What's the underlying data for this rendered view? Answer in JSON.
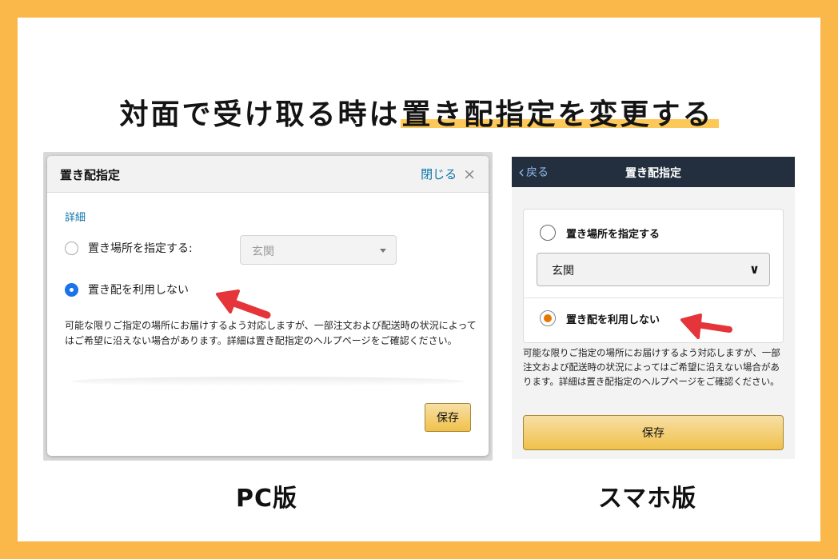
{
  "headline": {
    "text_plain": "対面で受け取る時は",
    "text_highlight": "置き配指定を変更する"
  },
  "pc": {
    "caption": "PC版",
    "dialog_title": "置き配指定",
    "close_label": "閉じる",
    "close_icon": "×",
    "section_label": "詳細",
    "option_specify_label": "置き場所を指定する:",
    "option_specify_selected": false,
    "select_value": "玄関",
    "option_none_label": "置き配を利用しない",
    "option_none_selected": true,
    "note": "可能な限りご指定の場所にお届けするよう対応しますが、一部注文および配送時の状況によってはご希望に沿えない場合があります。詳細は置き配指定のヘルプページをご確認ください。",
    "save_label": "保存"
  },
  "sp": {
    "caption": "スマホ版",
    "back_label": "戻る",
    "nav_title": "置き配指定",
    "option_specify_label": "置き場所を指定する",
    "option_specify_selected": false,
    "select_value": "玄関",
    "option_none_label": "置き配を利用しない",
    "option_none_selected": true,
    "note": "可能な限りご指定の場所にお届けするよう対応しますが、一部注文および配送時の状況によってはご希望に沿えない場合があります。詳細は置き配指定のヘルプページをご確認ください。",
    "save_label": "保存"
  },
  "colors": {
    "background": "#fbb84a",
    "highlight": "#fdc85a",
    "link_blue": "#0b74a8",
    "radio_blue": "#1a73e8",
    "radio_orange": "#e77600",
    "arrow_red": "#e5343a",
    "nav_dark": "#232f3e",
    "button_yellow": "#f0c14b"
  }
}
